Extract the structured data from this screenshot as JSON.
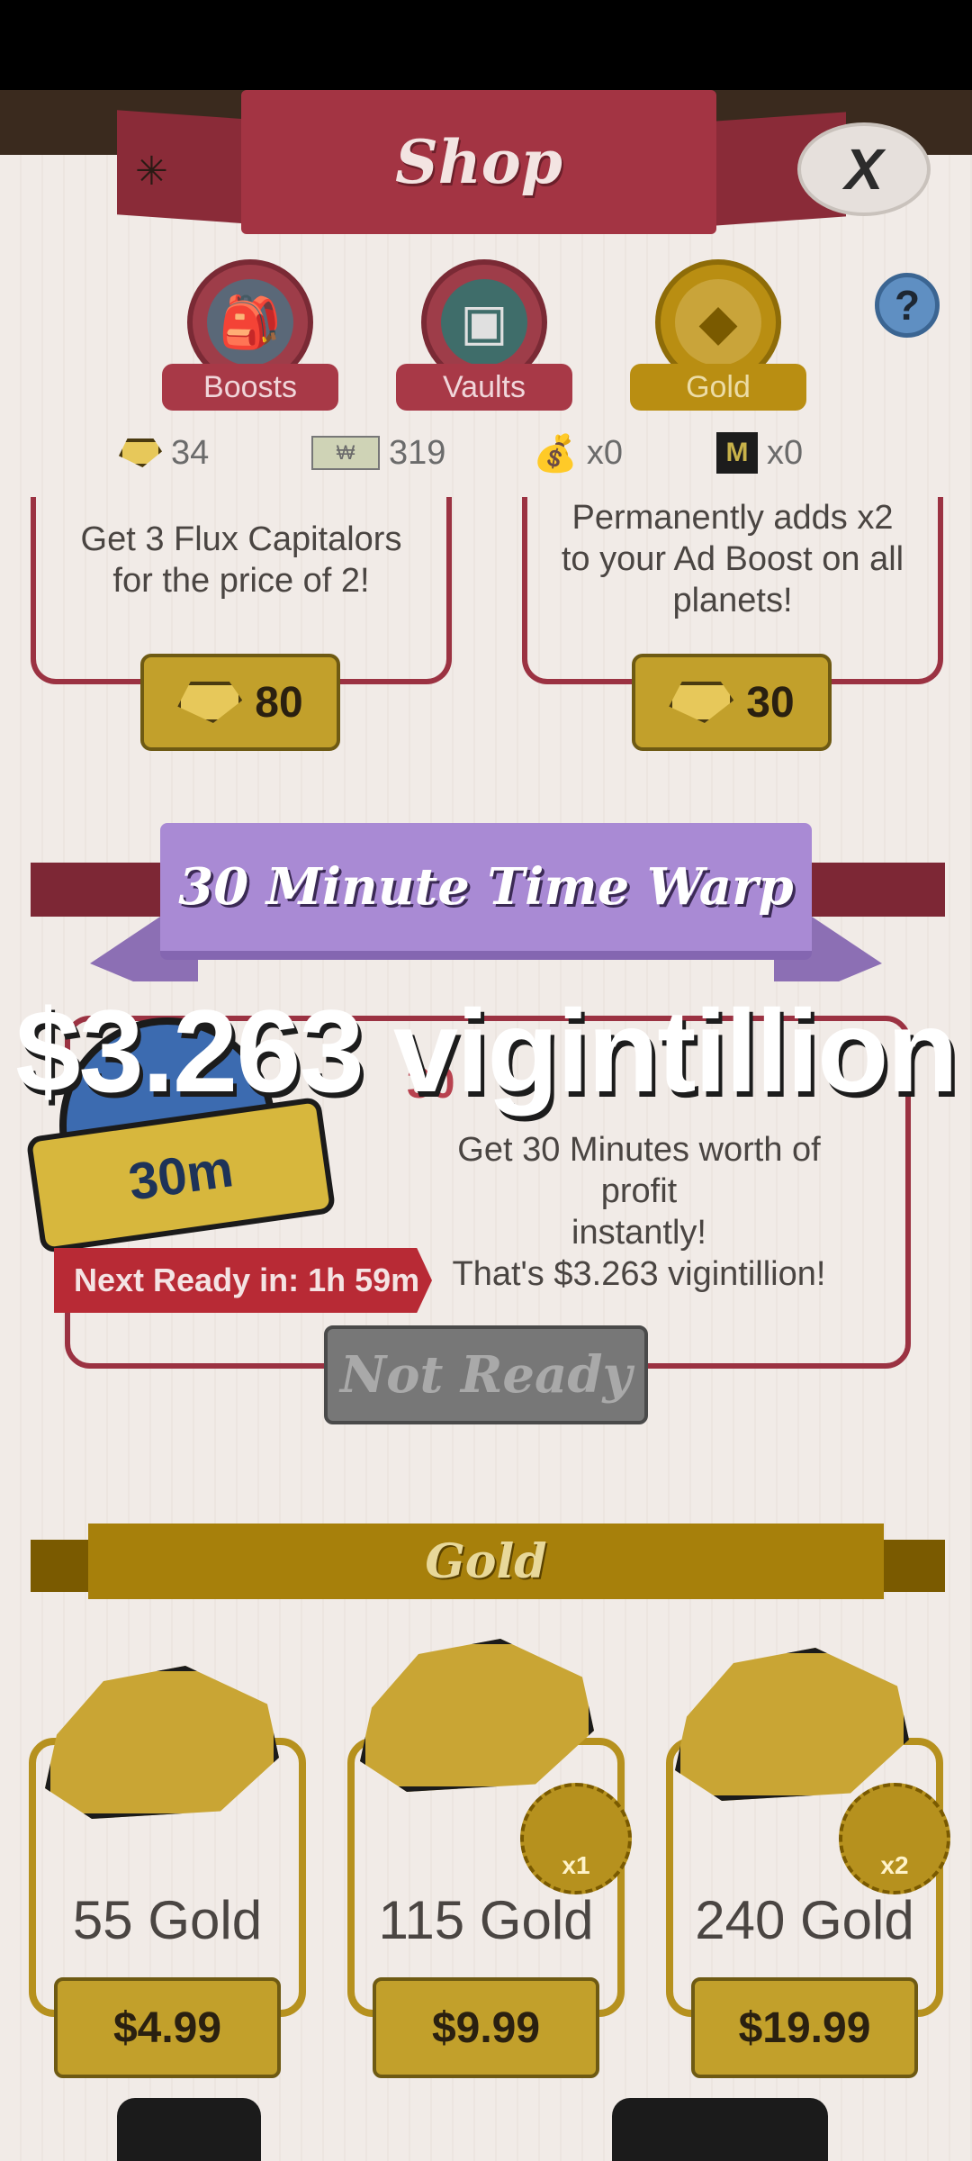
{
  "header": {
    "title": "Shop",
    "close_label": "X",
    "help_label": "?"
  },
  "tabs": [
    {
      "label": "Boosts",
      "icon": "boost-bag-icon"
    },
    {
      "label": "Vaults",
      "icon": "vault-icon"
    },
    {
      "label": "Gold",
      "icon": "gold-gem-icon"
    }
  ],
  "currencies": [
    {
      "icon": "gold-gem-icon",
      "value": "34"
    },
    {
      "icon": "megabucks-icon",
      "value": "319"
    },
    {
      "icon": "money-bag-icon",
      "value": "x0"
    },
    {
      "icon": "mega-ticket-icon",
      "value": "x0"
    }
  ],
  "offers": [
    {
      "description_1": "Get 3 Flux Capitalors",
      "description_2": "for the price of 2!",
      "price": "80"
    },
    {
      "description_1": "Permanently adds x2",
      "description_2": "to your Ad Boost on all",
      "description_3": "planets!",
      "price": "30"
    }
  ],
  "time_warp": {
    "ribbon_title": "30 Minute Time Warp",
    "amount": "$3.263 vigintillion",
    "badge": "30m",
    "partial_title": "30",
    "desc_1": "Get 30 Minutes worth of profit",
    "desc_2": "instantly!",
    "desc_3": "That's $3.263 vigintillion!",
    "next_ready": "Next Ready in: 1h 59m",
    "button": "Not Ready"
  },
  "gold_section": {
    "title": "Gold",
    "packs": [
      {
        "label": "55 Gold",
        "price": "$4.99",
        "bonus": ""
      },
      {
        "label": "115 Gold",
        "price": "$9.99",
        "bonus": "x1"
      },
      {
        "label": "240 Gold",
        "price": "$19.99",
        "bonus": "x2"
      }
    ]
  },
  "colors": {
    "accent_red": "#a33443",
    "gold": "#c2a02b",
    "purple_ribbon": "#a98ad4"
  }
}
